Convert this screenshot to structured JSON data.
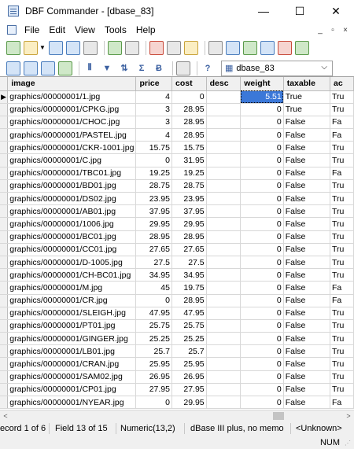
{
  "window": {
    "title": "DBF Commander - [dbase_83]",
    "minimize_glyph": "—",
    "maximize_glyph": "☐",
    "close_glyph": "✕"
  },
  "menu": {
    "items": [
      "File",
      "Edit",
      "View",
      "Tools",
      "Help"
    ],
    "mdi": [
      "_",
      "▫",
      "×"
    ]
  },
  "toolbar": {
    "table_selector": "dbase_83",
    "sum_glyph": "Σ",
    "filter_glyph": "▼",
    "help_glyph": "?"
  },
  "grid": {
    "columns": [
      "image",
      "price",
      "cost",
      "desc",
      "weight",
      "taxable",
      "ac"
    ],
    "rows": [
      [
        "graphics/00000001/1.jpg",
        "4",
        "0",
        "",
        "5.51",
        "True",
        "Tru"
      ],
      [
        "graphics/00000001/CPKG.jpg",
        "3",
        "28.95",
        "",
        "0",
        "True",
        "Tru"
      ],
      [
        "graphics/00000001/CHOC.jpg",
        "3",
        "28.95",
        "",
        "0",
        "False",
        "Fa"
      ],
      [
        "graphics/00000001/PASTEL.jpg",
        "4",
        "28.95",
        "",
        "0",
        "False",
        "Fa"
      ],
      [
        "graphics/00000001/CKR-1001.jpg",
        "15.75",
        "15.75",
        "",
        "0",
        "False",
        "Tru"
      ],
      [
        "graphics/00000001/C.jpg",
        "0",
        "31.95",
        "",
        "0",
        "False",
        "Tru"
      ],
      [
        "graphics/00000001/TBC01.jpg",
        "19.25",
        "19.25",
        "",
        "0",
        "False",
        "Fa"
      ],
      [
        "graphics/00000001/BD01.jpg",
        "28.75",
        "28.75",
        "",
        "0",
        "False",
        "Tru"
      ],
      [
        "graphics/00000001/DS02.jpg",
        "23.95",
        "23.95",
        "",
        "0",
        "False",
        "Tru"
      ],
      [
        "graphics/00000001/AB01.jpg",
        "37.95",
        "37.95",
        "",
        "0",
        "False",
        "Tru"
      ],
      [
        "graphics/00000001/1006.jpg",
        "29.95",
        "29.95",
        "",
        "0",
        "False",
        "Tru"
      ],
      [
        "graphics/00000001/BC01.jpg",
        "28.95",
        "28.95",
        "",
        "0",
        "False",
        "Tru"
      ],
      [
        "graphics/00000001/CC01.jpg",
        "27.65",
        "27.65",
        "",
        "0",
        "False",
        "Tru"
      ],
      [
        "graphics/00000001/D-1005.jpg",
        "27.5",
        "27.5",
        "",
        "0",
        "False",
        "Tru"
      ],
      [
        "graphics/00000001/CH-BC01.jpg",
        "34.95",
        "34.95",
        "",
        "0",
        "False",
        "Tru"
      ],
      [
        "graphics/00000001/M.jpg",
        "45",
        "19.75",
        "",
        "0",
        "False",
        "Fa"
      ],
      [
        "graphics/00000001/CR.jpg",
        "0",
        "28.95",
        "",
        "0",
        "False",
        "Fa"
      ],
      [
        "graphics/00000001/SLEIGH.jpg",
        "47.95",
        "47.95",
        "",
        "0",
        "False",
        "Tru"
      ],
      [
        "graphics/00000001/PT01.jpg",
        "25.75",
        "25.75",
        "",
        "0",
        "False",
        "Tru"
      ],
      [
        "graphics/00000001/GINGER.jpg",
        "25.25",
        "25.25",
        "",
        "0",
        "False",
        "Tru"
      ],
      [
        "graphics/00000001/LB01.jpg",
        "25.7",
        "25.7",
        "",
        "0",
        "False",
        "Tru"
      ],
      [
        "graphics/00000001/CRAN.jpg",
        "25.95",
        "25.95",
        "",
        "0",
        "False",
        "Tru"
      ],
      [
        "graphics/00000001/SAM02.jpg",
        "26.95",
        "26.95",
        "",
        "0",
        "False",
        "Tru"
      ],
      [
        "graphics/00000001/CP01.jpg",
        "27.95",
        "27.95",
        "",
        "0",
        "False",
        "Tru"
      ],
      [
        "graphics/00000001/NYEAR.jpg",
        "0",
        "29.95",
        "",
        "0",
        "False",
        "Fa"
      ]
    ]
  },
  "status": {
    "record": "ecord 1 of 6",
    "field": "Field 13 of 15",
    "type": "Numeric(13,2)",
    "format": "dBase III plus, no memo",
    "encoding": "<Unknown>",
    "num": "NUM"
  },
  "scroll": {
    "left_glyph": "<",
    "right_glyph": ">"
  }
}
